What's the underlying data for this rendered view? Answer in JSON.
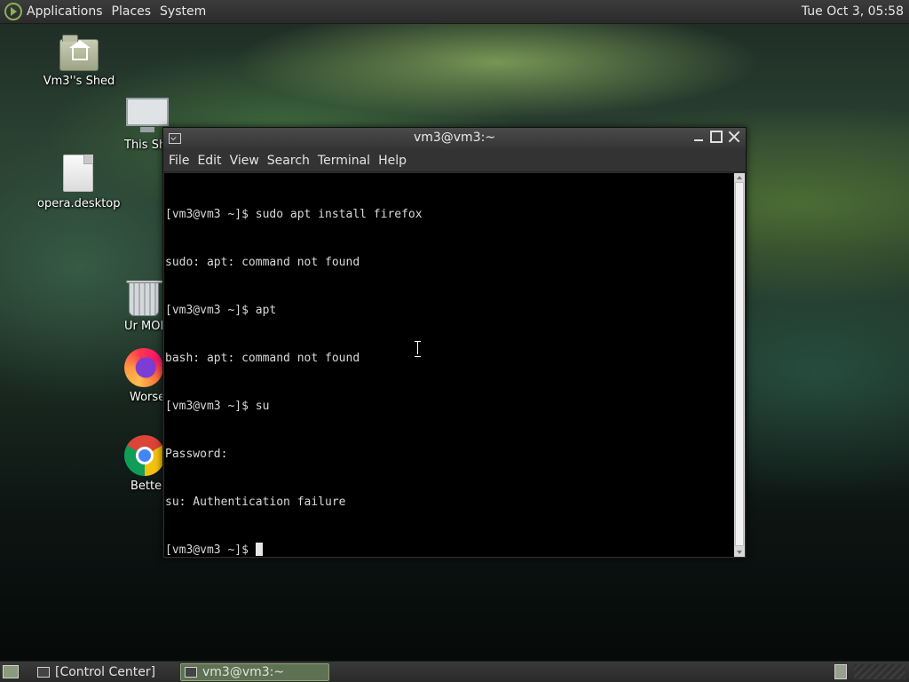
{
  "top_panel": {
    "menus": [
      "Applications",
      "Places",
      "System"
    ],
    "clock": "Tue Oct  3, 05:58"
  },
  "desktop": {
    "icons": [
      {
        "label": "Vm3''s Shed",
        "icon": "home-folder-icon"
      },
      {
        "label": "This Sh",
        "icon": "computer-icon"
      },
      {
        "label": "opera.desktop",
        "icon": "file-icon"
      },
      {
        "label": "Ur MOM",
        "icon": "trash-icon"
      },
      {
        "label": "Worse",
        "icon": "firefox-icon"
      },
      {
        "label": "Better",
        "icon": "chrome-icon"
      }
    ]
  },
  "terminal": {
    "title": "vm3@vm3:~",
    "menu": [
      "File",
      "Edit",
      "View",
      "Search",
      "Terminal",
      "Help"
    ],
    "lines": [
      "[vm3@vm3 ~]$ sudo apt install firefox",
      "sudo: apt: command not found",
      "[vm3@vm3 ~]$ apt",
      "bash: apt: command not found",
      "[vm3@vm3 ~]$ su",
      "Password:",
      "su: Authentication failure",
      "[vm3@vm3 ~]$ "
    ]
  },
  "bottom_panel": {
    "tasks": [
      "[Control Center]",
      "vm3@vm3:~"
    ]
  },
  "colors": {
    "accent": "#87b158",
    "terminal_bg": "#000000",
    "active_task": "#5e7253"
  }
}
